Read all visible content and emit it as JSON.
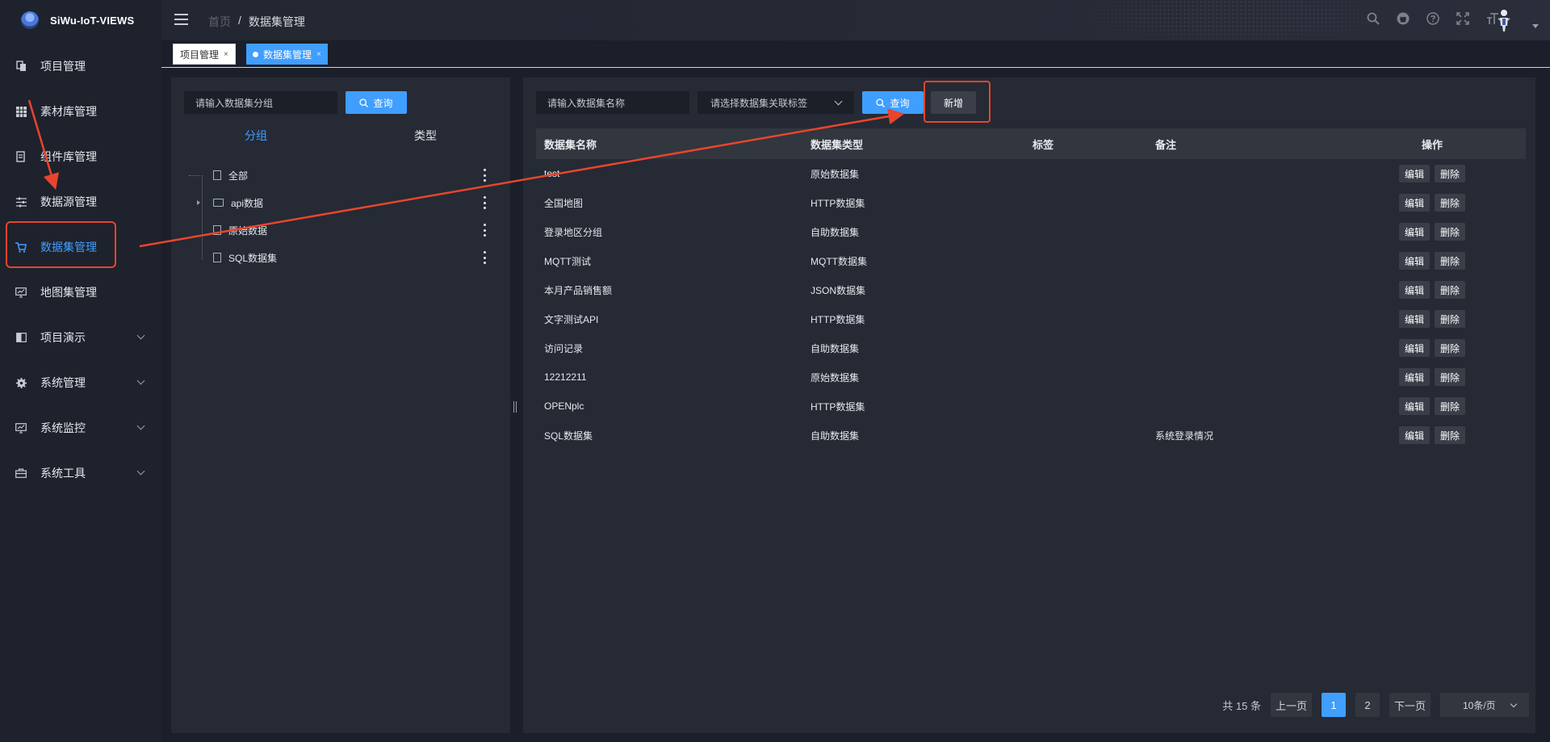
{
  "app": {
    "name": "SiWu-IoT-VIEWS"
  },
  "sidebar": {
    "items": [
      {
        "label": "项目管理",
        "icon": "copy-icon"
      },
      {
        "label": "素材库管理",
        "icon": "grid-icon"
      },
      {
        "label": "组件库管理",
        "icon": "file-text-icon"
      },
      {
        "label": "数据源管理",
        "icon": "sliders-icon"
      },
      {
        "label": "数据集管理",
        "icon": "cart-icon",
        "active": true
      },
      {
        "label": "地图集管理",
        "icon": "monitor-chart-icon"
      },
      {
        "label": "项目演示",
        "icon": "book-icon",
        "expandable": true
      },
      {
        "label": "系统管理",
        "icon": "gear-icon",
        "expandable": true
      },
      {
        "label": "系统监控",
        "icon": "monitor-icon",
        "expandable": true
      },
      {
        "label": "系统工具",
        "icon": "toolbox-icon",
        "expandable": true
      }
    ]
  },
  "header": {
    "breadcrumb": {
      "home": "首页",
      "sep": "/",
      "current": "数据集管理"
    },
    "icons": [
      "search-icon",
      "github-icon",
      "help-icon",
      "fullscreen-icon",
      "font-size-icon"
    ]
  },
  "tags": [
    {
      "label": "项目管理",
      "close": "×"
    },
    {
      "label": "数据集管理",
      "close": "×",
      "active": true
    }
  ],
  "left": {
    "search_placeholder": "请输入数据集分组",
    "search_button": "查询",
    "tabs": [
      "分组",
      "类型"
    ],
    "tree": [
      {
        "label": "全部",
        "kind": "file"
      },
      {
        "label": "api数据",
        "kind": "folder",
        "expandable": true
      },
      {
        "label": "原始数据",
        "kind": "file"
      },
      {
        "label": "SQL数据集",
        "kind": "file"
      }
    ]
  },
  "right": {
    "name_placeholder": "请输入数据集名称",
    "tag_select_placeholder": "请选择数据集关联标签",
    "search_button": "查询",
    "add_button": "新增",
    "columns": [
      "数据集名称",
      "数据集类型",
      "标签",
      "备注",
      "操作"
    ],
    "rows": [
      {
        "name": "test",
        "type": "原始数据集",
        "tag": "",
        "remark": ""
      },
      {
        "name": "全国地图",
        "type": "HTTP数据集",
        "tag": "",
        "remark": ""
      },
      {
        "name": "登录地区分组",
        "type": "自助数据集",
        "tag": "",
        "remark": ""
      },
      {
        "name": "MQTT测试",
        "type": "MQTT数据集",
        "tag": "",
        "remark": ""
      },
      {
        "name": "本月产品销售额",
        "type": "JSON数据集",
        "tag": "",
        "remark": ""
      },
      {
        "name": "文字测试API",
        "type": "HTTP数据集",
        "tag": "",
        "remark": ""
      },
      {
        "name": "访问记录",
        "type": "自助数据集",
        "tag": "",
        "remark": ""
      },
      {
        "name": "12212211",
        "type": "原始数据集",
        "tag": "",
        "remark": ""
      },
      {
        "name": "OPENplc",
        "type": "HTTP数据集",
        "tag": "",
        "remark": ""
      },
      {
        "name": "SQL数据集",
        "type": "自助数据集",
        "tag": "",
        "remark": "系统登录情况"
      }
    ],
    "row_actions": {
      "edit": "编辑",
      "delete": "删除"
    },
    "pagination": {
      "total": "共 15 条",
      "prev": "上一页",
      "pages": [
        "1",
        "2"
      ],
      "current": "1",
      "next": "下一页",
      "size": "10条/页"
    }
  },
  "colors": {
    "accent": "#409eff",
    "annotation": "#e8452c"
  }
}
